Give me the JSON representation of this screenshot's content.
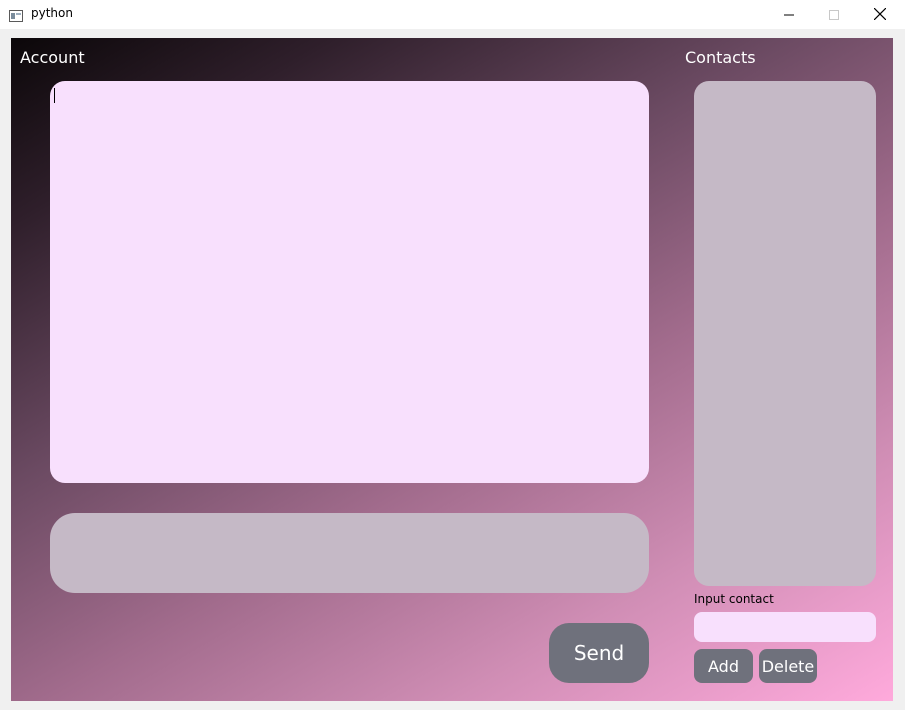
{
  "window": {
    "title": "python",
    "icon": "window-app-icon",
    "controls": [
      "minimize-icon",
      "maximize-icon",
      "close-icon"
    ]
  },
  "account": {
    "label": "Account"
  },
  "chat": {
    "display_text": "",
    "message_input_value": "",
    "send_label": "Send"
  },
  "contacts": {
    "label": "Contacts",
    "items": [],
    "input_label": "Input contact",
    "input_value": "",
    "add_label": "Add",
    "delete_label": "Delete"
  },
  "colors": {
    "panel_light": "#f8e0fd",
    "panel_gray": "#c5b9c6",
    "button": "#6f717c",
    "gradient_start": "#0b0709",
    "gradient_end": "#ffaadc"
  }
}
